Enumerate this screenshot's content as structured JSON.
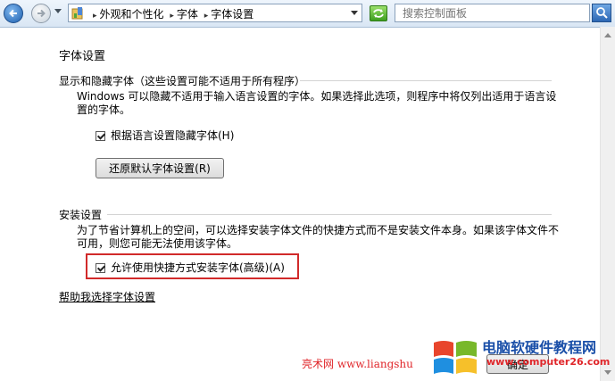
{
  "nav": {
    "breadcrumbs": [
      "外观和个性化",
      "字体",
      "字体设置"
    ],
    "search_placeholder": "搜索控制面板"
  },
  "main": {
    "title": "字体设置",
    "show_hide": {
      "heading": "显示和隐藏字体（这些设置可能不适用于所有程序）",
      "description": "Windows 可以隐藏不适用于输入语言设置的字体。如果选择此选项，则程序中将仅列出适用于语言设置的字体。",
      "checkbox_label": "根据语言设置隐藏字体(H)",
      "checked": true,
      "restore_button": "还原默认字体设置(R)"
    },
    "install": {
      "heading": "安装设置",
      "description": "为了节省计算机上的空间，可以选择安装字体文件的快捷方式而不是安装文件本身。如果该字体文件不可用，则您可能无法使用该字体。",
      "checkbox_label": "允许使用快捷方式安装字体(高级)(A)",
      "checked": true
    },
    "help_link": "帮助我选择字体设置",
    "ok_button": "确定"
  },
  "watermark": {
    "title": "电脑软硬件教程网",
    "site": "www.computer26.com",
    "left_text": "亮术网 www.liangshu"
  },
  "colors": {
    "highlight_box": "#d12a2a",
    "watermark_blue": "#1a4fa8",
    "watermark_red": "#e0262a"
  }
}
